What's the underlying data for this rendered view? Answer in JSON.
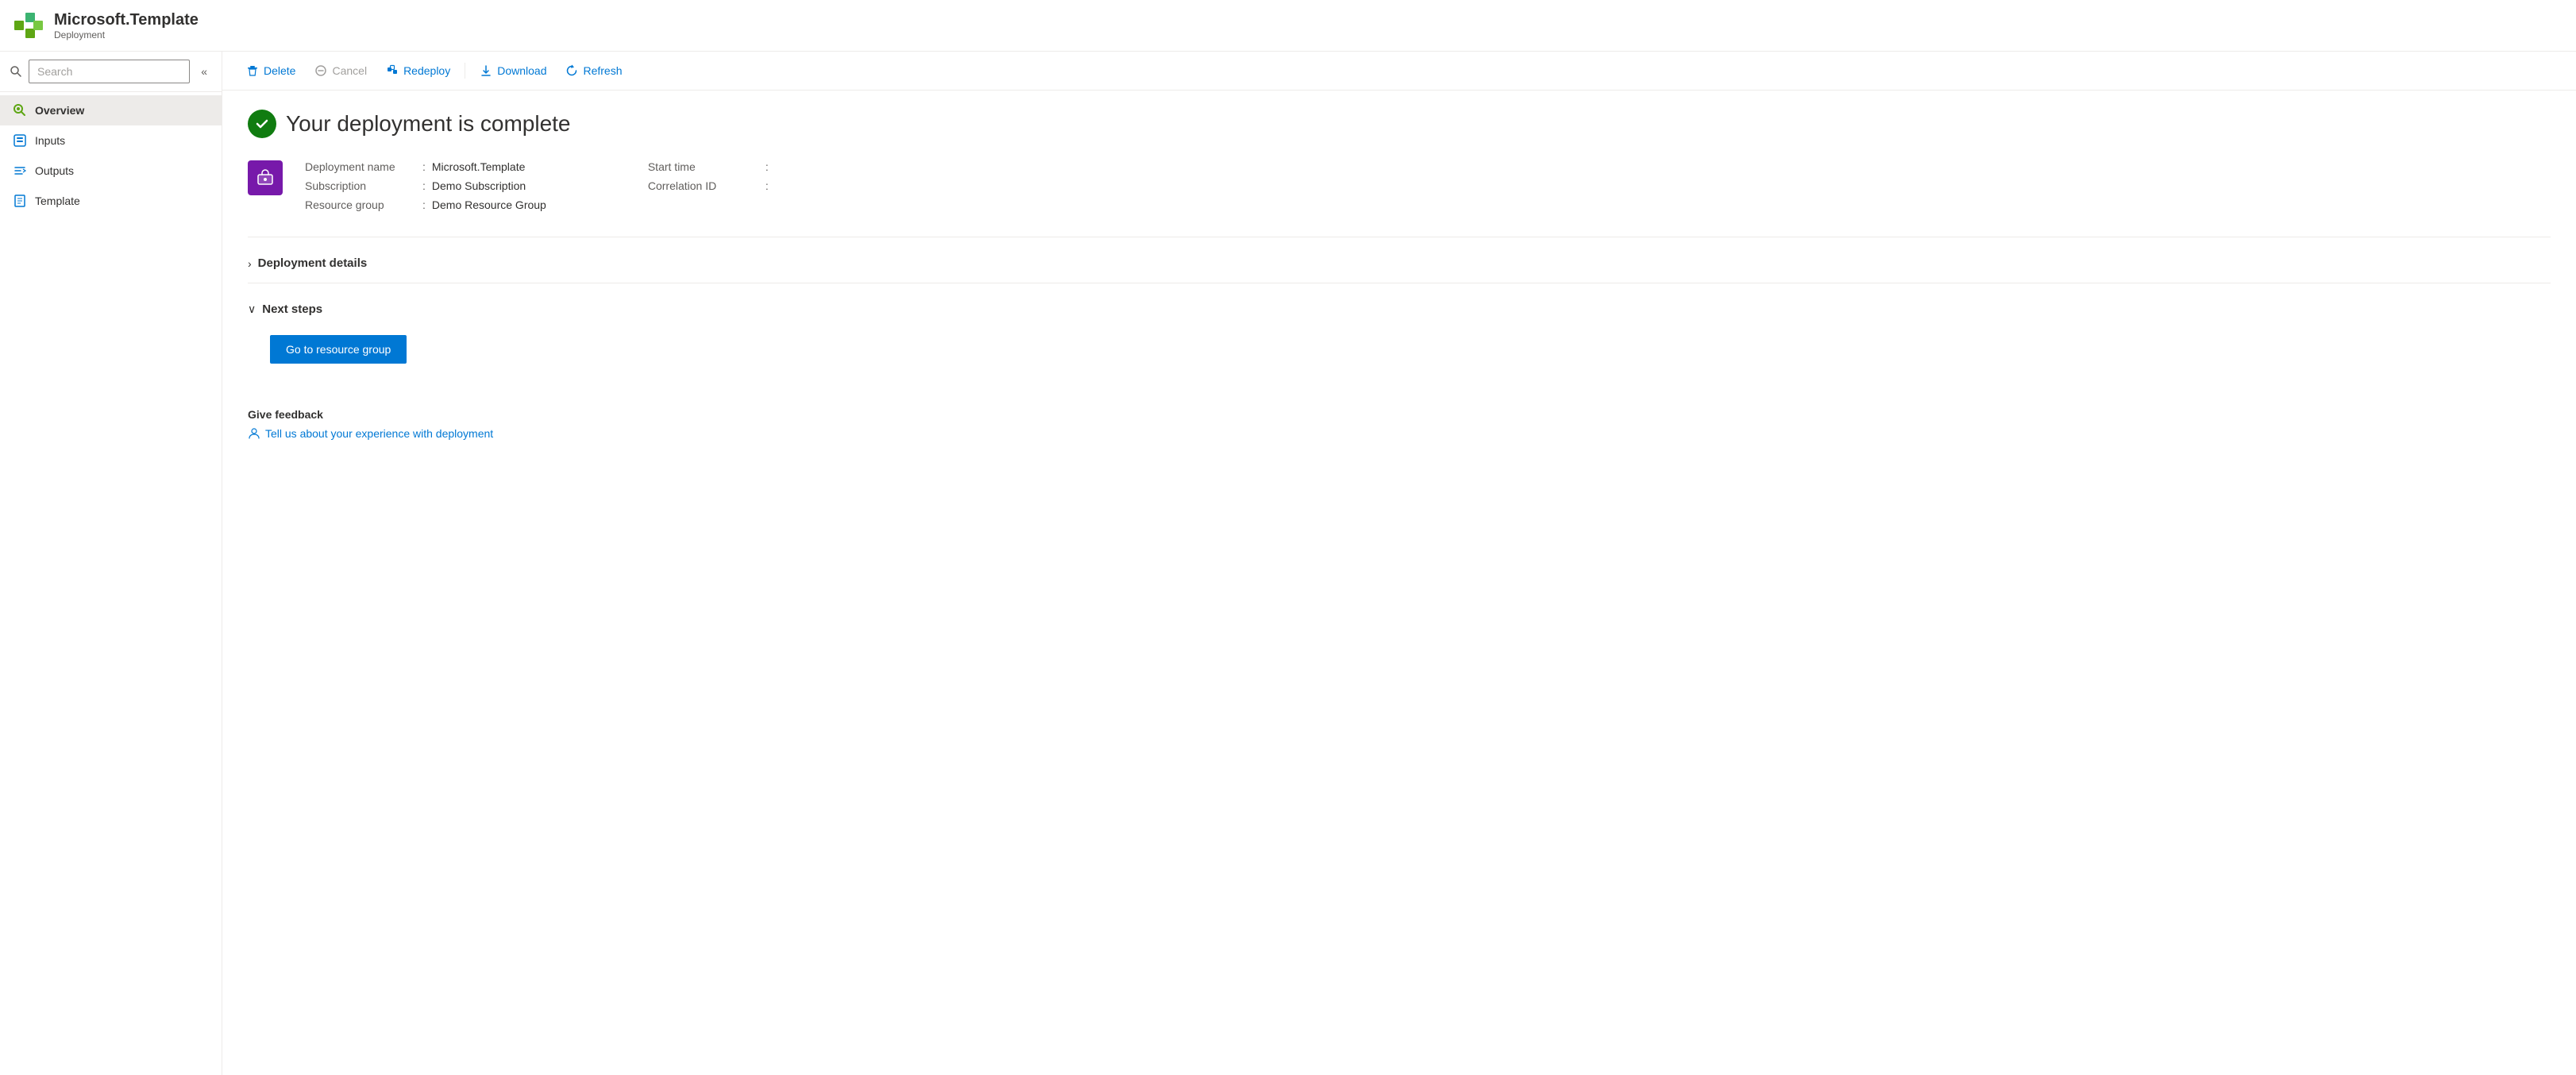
{
  "header": {
    "title": "Microsoft.Template",
    "subtitle": "Deployment"
  },
  "sidebar": {
    "search_placeholder": "Search",
    "collapse_label": "«",
    "nav_items": [
      {
        "id": "overview",
        "label": "Overview",
        "icon": "overview-icon",
        "active": true
      },
      {
        "id": "inputs",
        "label": "Inputs",
        "icon": "inputs-icon",
        "active": false
      },
      {
        "id": "outputs",
        "label": "Outputs",
        "icon": "outputs-icon",
        "active": false
      },
      {
        "id": "template",
        "label": "Template",
        "icon": "template-icon",
        "active": false
      }
    ]
  },
  "toolbar": {
    "delete_label": "Delete",
    "cancel_label": "Cancel",
    "redeploy_label": "Redeploy",
    "download_label": "Download",
    "refresh_label": "Refresh"
  },
  "content": {
    "deployment_status": "Your deployment is complete",
    "deployment_icon_letter": "📦",
    "fields": {
      "deployment_name_label": "Deployment name",
      "deployment_name_value": "Microsoft.Template",
      "subscription_label": "Subscription",
      "subscription_value": "Demo Subscription",
      "resource_group_label": "Resource group",
      "resource_group_value": "Demo Resource Group",
      "start_time_label": "Start time",
      "start_time_value": "",
      "correlation_id_label": "Correlation ID",
      "correlation_id_value": ""
    },
    "sections": {
      "deployment_details_label": "Deployment details",
      "deployment_details_expanded": false,
      "next_steps_label": "Next steps",
      "next_steps_expanded": true
    },
    "goto_button_label": "Go to resource group",
    "feedback": {
      "title": "Give feedback",
      "link_text": "Tell us about your experience with deployment"
    }
  }
}
